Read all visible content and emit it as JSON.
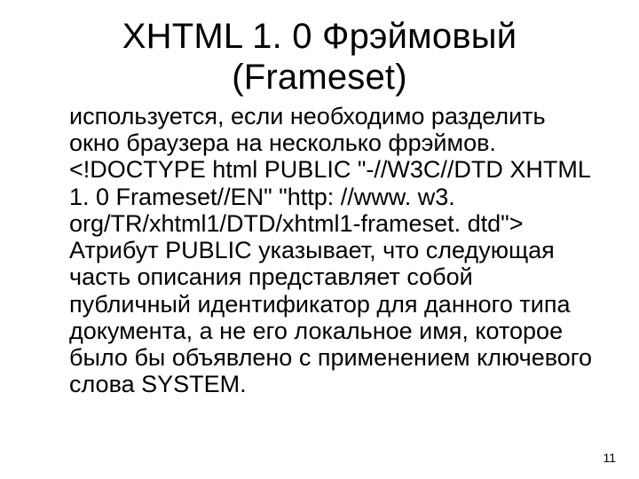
{
  "title": "XHTML 1. 0 Фрэймовый (Frameset)",
  "para1": "используется, если необходимо разделить окно браузера на несколько фрэймов.",
  "para2": "<!DOCTYPE html PUBLIC \"-//W3C//DTD XHTML 1. 0 Frameset//EN\" \"http: //www. w3. org/TR/xhtml1/DTD/xhtml1-frameset. dtd\">",
  "para3": "Атрибут PUBLIC указывает, что следующая часть описания представляет собой публичный идентификатор для данного типа документа, а не его локальное имя, которое было бы объявлено с применением ключевого слова SYSTEM.",
  "page_number": "11"
}
